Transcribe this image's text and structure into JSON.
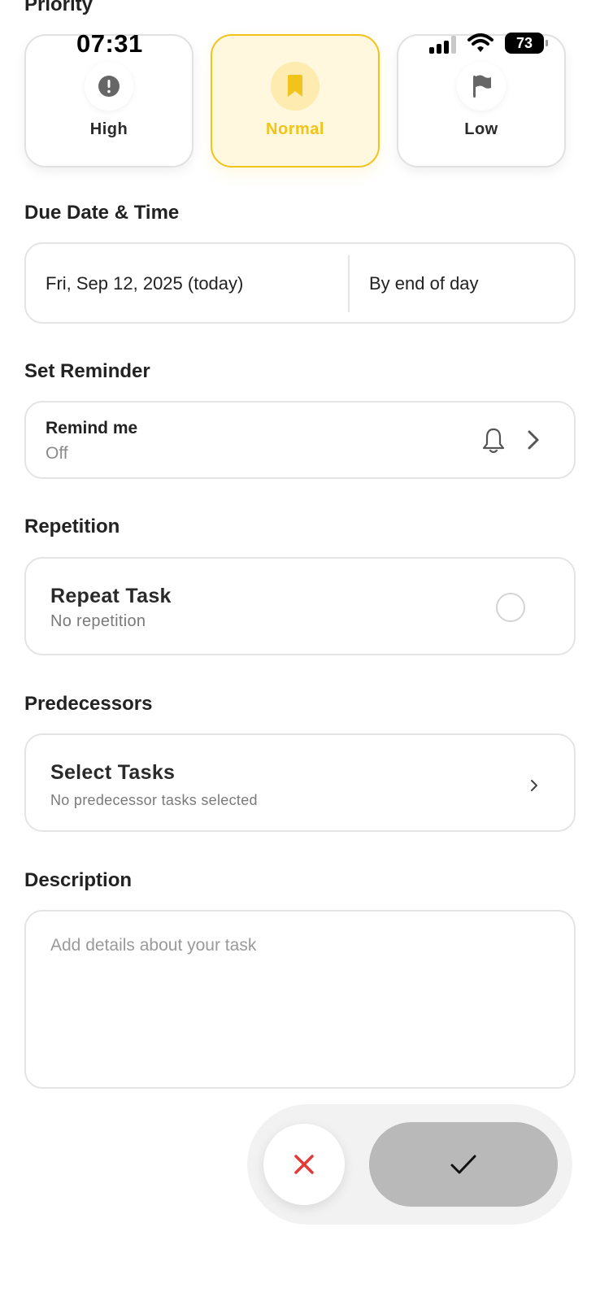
{
  "status_bar": {
    "time": "07:31",
    "battery": "73"
  },
  "priority": {
    "title": "Priority",
    "options": [
      {
        "label": "High",
        "icon": "alert-circle-icon",
        "selected": false
      },
      {
        "label": "Normal",
        "icon": "bookmark-icon",
        "selected": true
      },
      {
        "label": "Low",
        "icon": "flag-icon",
        "selected": false
      }
    ],
    "accent_color": "#f2c31a"
  },
  "due": {
    "title": "Due Date & Time",
    "date": "Fri, Sep 12, 2025 (today)",
    "time": "By end of day"
  },
  "reminder": {
    "title": "Set Reminder",
    "label": "Remind me",
    "value": "Off"
  },
  "repetition": {
    "title": "Repetition",
    "label": "Repeat Task",
    "value": "No repetition"
  },
  "predecessors": {
    "title": "Predecessors",
    "label": "Select Tasks",
    "value": "No predecessor tasks selected"
  },
  "description": {
    "title": "Description",
    "placeholder": "Add details about your task",
    "value": ""
  },
  "actions": {
    "cancel_icon": "close-icon",
    "confirm_icon": "checkmark-icon",
    "cancel_color": "#e53935"
  }
}
